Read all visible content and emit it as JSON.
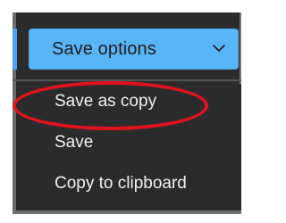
{
  "colors": {
    "button_bg": "#58b5f7",
    "panel_bg": "#2b2b2b",
    "highlight": "#e0131f"
  },
  "save_options": {
    "label": "Save options",
    "icon": "chevron-down-icon"
  },
  "menu": {
    "items": [
      {
        "label": "Save as copy"
      },
      {
        "label": "Save"
      },
      {
        "label": "Copy to clipboard"
      }
    ]
  },
  "annotation": {
    "target": "Save as copy",
    "shape": "ellipse"
  }
}
